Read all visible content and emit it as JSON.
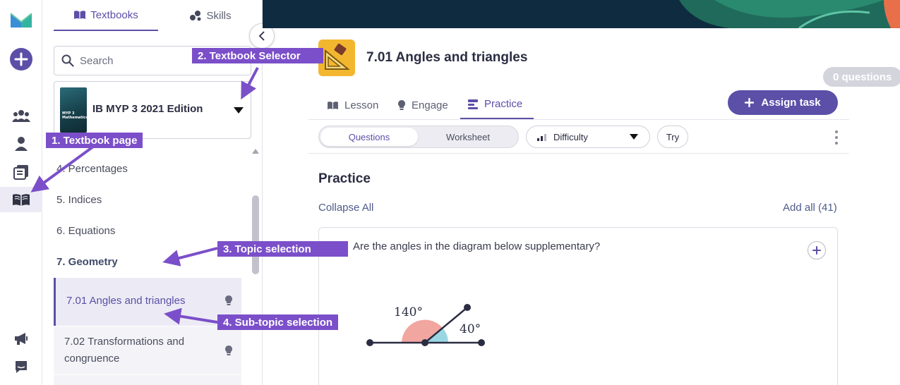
{
  "left_rail": {
    "items": [
      {
        "icon": "logo-m-icon"
      },
      {
        "icon": "add-circle-icon"
      },
      {
        "icon": "classes-people-icon"
      },
      {
        "icon": "person-icon"
      },
      {
        "icon": "books-stack-icon"
      },
      {
        "icon": "open-book-icon",
        "active": true
      },
      {
        "icon": "megaphone-icon"
      },
      {
        "icon": "chat-inbox-icon"
      }
    ]
  },
  "sidebar": {
    "tabs": [
      {
        "label": "Textbooks",
        "icon": "book-icon",
        "active": true
      },
      {
        "label": "Skills",
        "icon": "skills-dots-icon",
        "active": false
      }
    ],
    "search": {
      "placeholder": "Search"
    },
    "textbook": {
      "title": "IB MYP 3 2021 Edition",
      "cover_text": "MYP 3 Mathematics"
    },
    "chapters": [
      {
        "label": "4. Percentages"
      },
      {
        "label": "5. Indices"
      },
      {
        "label": "6. Equations"
      },
      {
        "label": "7. Geometry",
        "selected": true
      }
    ],
    "subtopics": [
      {
        "label": "7.01 Angles and triangles",
        "active": true,
        "icon": "lightbulb-icon"
      },
      {
        "label_line1": "7.02 Transformations and",
        "label_line2": "congruence",
        "active": false,
        "icon": "lightbulb-icon"
      }
    ]
  },
  "header": {
    "lesson_title": "7.01 Angles and triangles",
    "question_count": "0 questions"
  },
  "main_tabs": [
    {
      "label": "Lesson",
      "icon": "book-icon"
    },
    {
      "label": "Engage",
      "icon": "lightbulb-icon"
    },
    {
      "label": "Practice",
      "icon": "practice-list-icon",
      "active": true
    }
  ],
  "assign_button": {
    "label": "Assign task"
  },
  "toolbar": {
    "segment": {
      "questions": "Questions",
      "worksheet": "Worksheet",
      "selected": "Questions"
    },
    "difficulty_label": "Difficulty",
    "try_label": "Try"
  },
  "practice": {
    "heading": "Practice",
    "collapse_all": "Collapse All",
    "add_all": "Add all (41)",
    "question": {
      "text": "Are the angles in the diagram below supplementary?",
      "angle_a": "140°",
      "angle_b": "40°"
    }
  },
  "annotations": [
    {
      "text": "1. Textbook page"
    },
    {
      "text": "2. Textbook Selector"
    },
    {
      "text": "3. Topic selection"
    },
    {
      "text": "4. Sub-topic selection"
    }
  ],
  "colors": {
    "accent": "#5b4fa8",
    "annotation": "#7b4fc9",
    "banner": "#0f2b40",
    "lesson_icon_bg": "#f3b62f",
    "angle_a_fill": "#f2a6a0",
    "angle_b_fill": "#9ad7e3"
  }
}
